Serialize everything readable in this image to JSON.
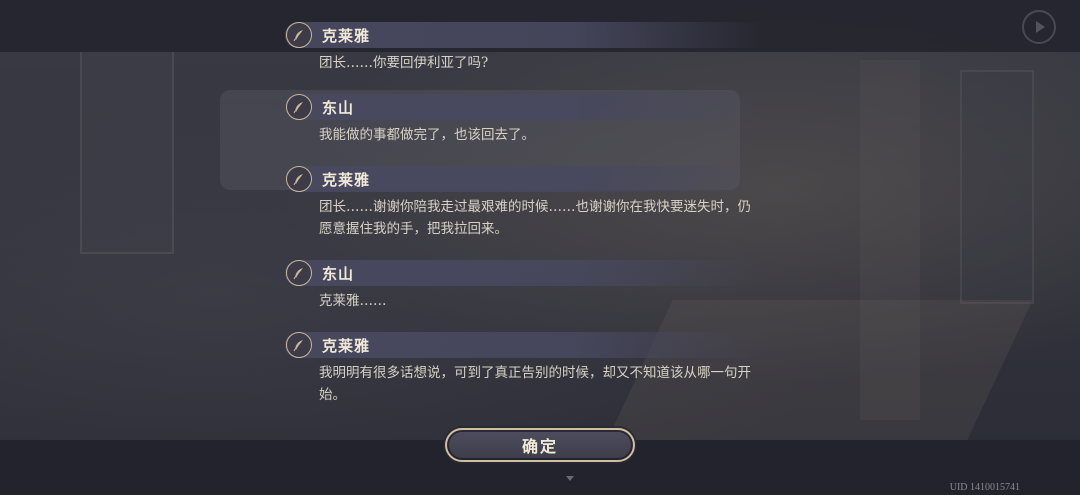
{
  "dialogue_log": [
    {
      "speaker": "克莱雅",
      "text": "团长……你要回伊利亚了吗?"
    },
    {
      "speaker": "东山",
      "text": "我能做的事都做完了，也该回去了。"
    },
    {
      "speaker": "克莱雅",
      "text": "团长……谢谢你陪我走过最艰难的时候……也谢谢你在我快要迷失时，仍愿意握住我的手，把我拉回来。"
    },
    {
      "speaker": "东山",
      "text": "克莱雅……"
    },
    {
      "speaker": "克莱雅",
      "text": "我明明有很多话想说，可到了真正告别的时候，却又不知道该从哪一句开始。"
    }
  ],
  "confirm_label": "确定",
  "uid": "UID 1410015741",
  "icons": {
    "speaker": "quill-icon",
    "top_right": "play-icon"
  },
  "colors": {
    "name_text": "#f2ead8",
    "body_text": "#d8d2c4",
    "accent_gold": "#cdbf9f",
    "bar_bg": "#48485f"
  }
}
